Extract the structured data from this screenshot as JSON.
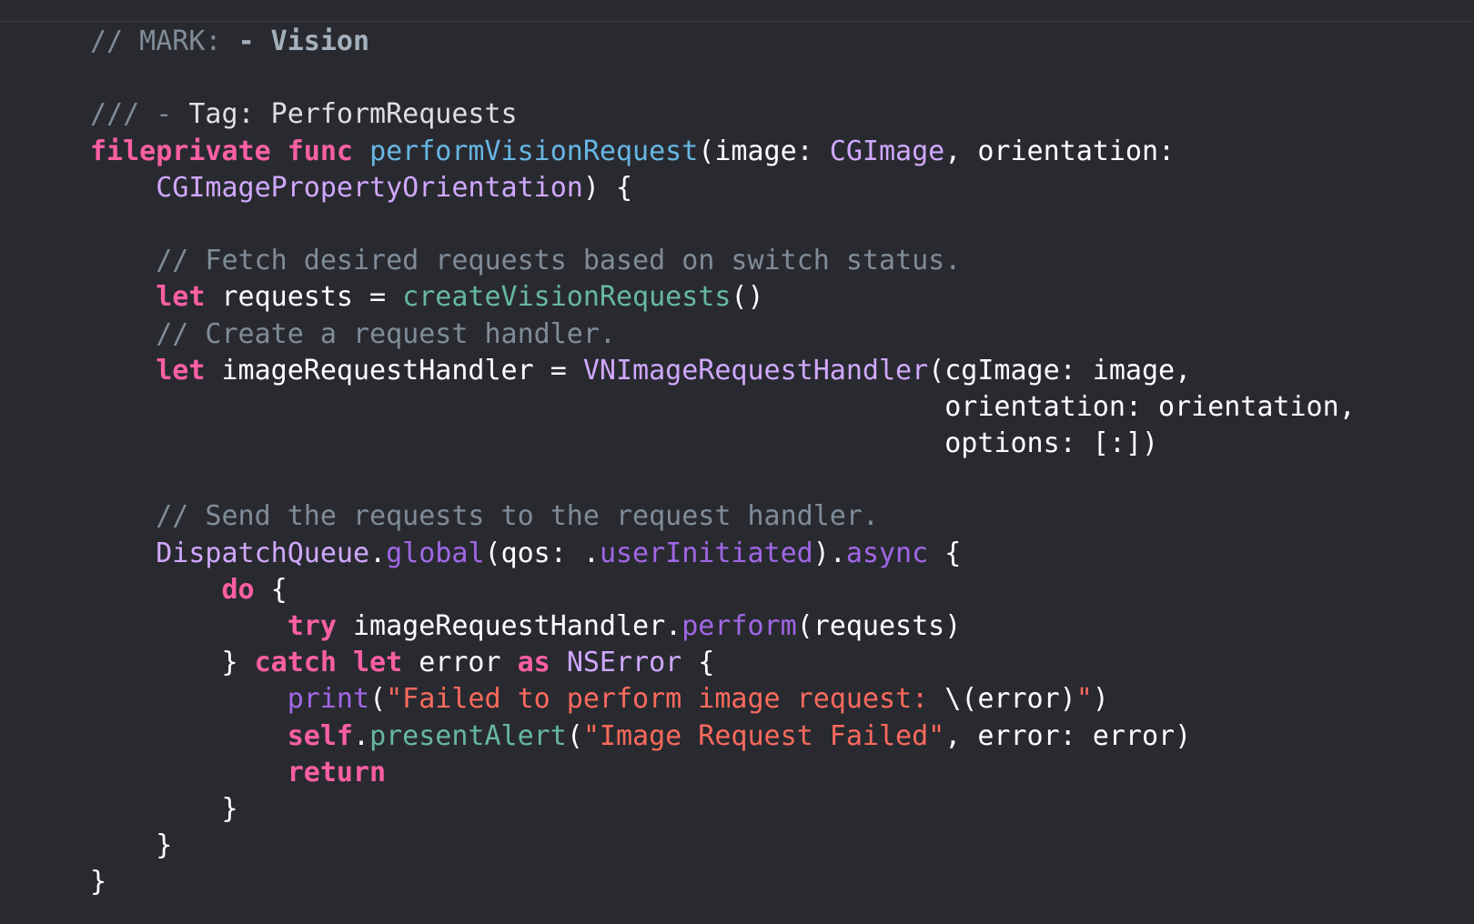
{
  "editor": {
    "language": "Swift",
    "theme_colors": {
      "background": "#292a30",
      "comment": "#7f8c98",
      "keyword": "#fc5fa3",
      "declaration": "#67b7e4",
      "type": "#d0a8ff",
      "project_function": "#67b7a4",
      "system_function": "#a167e6",
      "string": "#fc6a5d",
      "plain": "#ffffff"
    },
    "lines": [
      [
        {
          "t": "// MARK: ",
          "c": "t-comment"
        },
        {
          "t": "- Vision",
          "c": "t-mark"
        }
      ],
      [],
      [
        {
          "t": "/// - ",
          "c": "t-doc"
        },
        {
          "t": "Tag: PerformRequests",
          "c": "t-docbold"
        }
      ],
      [
        {
          "t": "fileprivate",
          "c": "t-kw"
        },
        {
          "t": " ",
          "c": "t-plain"
        },
        {
          "t": "func",
          "c": "t-kw"
        },
        {
          "t": " ",
          "c": "t-plain"
        },
        {
          "t": "performVisionRequest",
          "c": "t-decl"
        },
        {
          "t": "(image: ",
          "c": "t-plain"
        },
        {
          "t": "CGImage",
          "c": "t-type"
        },
        {
          "t": ", orientation:",
          "c": "t-plain"
        }
      ],
      [
        {
          "t": "    ",
          "c": "t-plain"
        },
        {
          "t": "CGImagePropertyOrientation",
          "c": "t-type"
        },
        {
          "t": ") {",
          "c": "t-plain"
        }
      ],
      [],
      [
        {
          "t": "    // Fetch desired requests based on switch status.",
          "c": "t-comment"
        }
      ],
      [
        {
          "t": "    ",
          "c": "t-plain"
        },
        {
          "t": "let",
          "c": "t-kw"
        },
        {
          "t": " requests = ",
          "c": "t-plain"
        },
        {
          "t": "createVisionRequests",
          "c": "t-projfn"
        },
        {
          "t": "()",
          "c": "t-plain"
        }
      ],
      [
        {
          "t": "    // Create a request handler.",
          "c": "t-comment"
        }
      ],
      [
        {
          "t": "    ",
          "c": "t-plain"
        },
        {
          "t": "let",
          "c": "t-kw"
        },
        {
          "t": " imageRequestHandler = ",
          "c": "t-plain"
        },
        {
          "t": "VNImageRequestHandler",
          "c": "t-type"
        },
        {
          "t": "(cgImage: image,",
          "c": "t-plain"
        }
      ],
      [
        {
          "t": "                                                    orientation: orientation,",
          "c": "t-plain"
        }
      ],
      [
        {
          "t": "                                                    options: [:])",
          "c": "t-plain"
        }
      ],
      [],
      [
        {
          "t": "    // Send the requests to the request handler.",
          "c": "t-comment"
        }
      ],
      [
        {
          "t": "    ",
          "c": "t-plain"
        },
        {
          "t": "DispatchQueue",
          "c": "t-type"
        },
        {
          "t": ".",
          "c": "t-plain"
        },
        {
          "t": "global",
          "c": "t-sysfn"
        },
        {
          "t": "(qos: .",
          "c": "t-plain"
        },
        {
          "t": "userInitiated",
          "c": "t-sysfn"
        },
        {
          "t": ").",
          "c": "t-plain"
        },
        {
          "t": "async",
          "c": "t-sysfn"
        },
        {
          "t": " {",
          "c": "t-plain"
        }
      ],
      [
        {
          "t": "        ",
          "c": "t-plain"
        },
        {
          "t": "do",
          "c": "t-kw"
        },
        {
          "t": " {",
          "c": "t-plain"
        }
      ],
      [
        {
          "t": "            ",
          "c": "t-plain"
        },
        {
          "t": "try",
          "c": "t-kw"
        },
        {
          "t": " imageRequestHandler.",
          "c": "t-plain"
        },
        {
          "t": "perform",
          "c": "t-sysfn"
        },
        {
          "t": "(requests)",
          "c": "t-plain"
        }
      ],
      [
        {
          "t": "        } ",
          "c": "t-plain"
        },
        {
          "t": "catch",
          "c": "t-kw"
        },
        {
          "t": " ",
          "c": "t-plain"
        },
        {
          "t": "let",
          "c": "t-kw"
        },
        {
          "t": " error ",
          "c": "t-plain"
        },
        {
          "t": "as",
          "c": "t-kw"
        },
        {
          "t": " ",
          "c": "t-plain"
        },
        {
          "t": "NSError",
          "c": "t-type"
        },
        {
          "t": " {",
          "c": "t-plain"
        }
      ],
      [
        {
          "t": "            ",
          "c": "t-plain"
        },
        {
          "t": "print",
          "c": "t-sysfn"
        },
        {
          "t": "(",
          "c": "t-plain"
        },
        {
          "t": "\"Failed to perform image request: ",
          "c": "t-str"
        },
        {
          "t": "\\(error)",
          "c": "t-plain"
        },
        {
          "t": "\"",
          "c": "t-str"
        },
        {
          "t": ")",
          "c": "t-plain"
        }
      ],
      [
        {
          "t": "            ",
          "c": "t-plain"
        },
        {
          "t": "self",
          "c": "t-kw"
        },
        {
          "t": ".",
          "c": "t-plain"
        },
        {
          "t": "presentAlert",
          "c": "t-projfn"
        },
        {
          "t": "(",
          "c": "t-plain"
        },
        {
          "t": "\"Image Request Failed\"",
          "c": "t-str"
        },
        {
          "t": ", error: error)",
          "c": "t-plain"
        }
      ],
      [
        {
          "t": "            ",
          "c": "t-plain"
        },
        {
          "t": "return",
          "c": "t-kw"
        }
      ],
      [
        {
          "t": "        }",
          "c": "t-plain"
        }
      ],
      [
        {
          "t": "    }",
          "c": "t-plain"
        }
      ],
      [
        {
          "t": "}",
          "c": "t-plain"
        }
      ]
    ]
  }
}
